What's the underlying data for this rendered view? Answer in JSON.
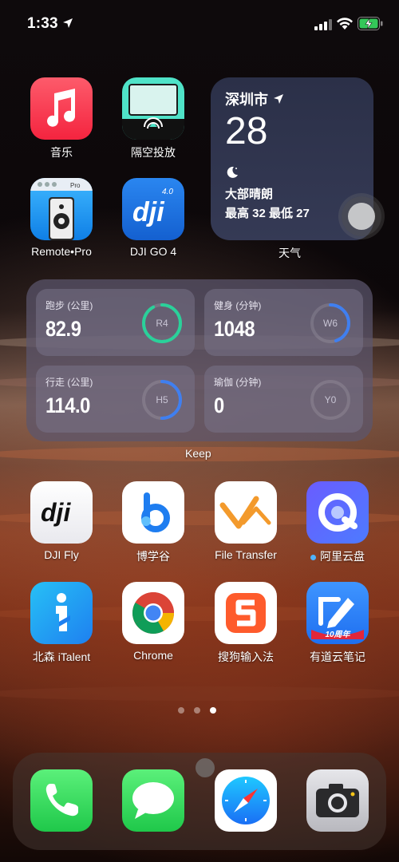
{
  "status_bar": {
    "time": "1:33"
  },
  "apps_row1": [
    {
      "label": "音乐"
    },
    {
      "label": "隔空投放"
    }
  ],
  "apps_row2": [
    {
      "label": "Remote•Pro"
    },
    {
      "label": "DJI GO 4"
    }
  ],
  "weather": {
    "city": "深圳市",
    "temperature": "28",
    "condition": "大部晴朗",
    "high_low": "最高 32 最低 27",
    "widget_label": "天气"
  },
  "keep": {
    "widget_label": "Keep",
    "cards": [
      {
        "label": "跑步 (公里)",
        "value": "82.9",
        "ring_label": "R4",
        "progress": 0.92,
        "color": "#2ad19a"
      },
      {
        "label": "健身 (分钟)",
        "value": "1048",
        "ring_label": "W6",
        "progress": 0.45,
        "color": "#3f7ff0"
      },
      {
        "label": "行走 (公里)",
        "value": "114.0",
        "ring_label": "H5",
        "progress": 0.5,
        "color": "#3f7ff0"
      },
      {
        "label": "瑜伽 (分钟)",
        "value": "0",
        "ring_label": "Y0",
        "progress": 0,
        "color": "#3f7ff0"
      }
    ]
  },
  "apps_row3": [
    {
      "label": "DJI Fly"
    },
    {
      "label": "博学谷"
    },
    {
      "label": "File Transfer"
    },
    {
      "label": "阿里云盘"
    }
  ],
  "apps_row4": [
    {
      "label": "北森 iTalent"
    },
    {
      "label": "Chrome"
    },
    {
      "label": "搜狗输入法"
    },
    {
      "label": "有道云笔记"
    }
  ],
  "youdao_badge": "10周年",
  "page_dots": {
    "count": 3,
    "active": 3
  },
  "dock": [
    {
      "icon": "phone-icon"
    },
    {
      "icon": "messages-icon"
    },
    {
      "icon": "safari-icon"
    },
    {
      "icon": "camera-icon"
    }
  ],
  "colors": {
    "music": "#fc3c44",
    "airplay_teal": "#4fe3c8",
    "dji_blue": "#1e6fe0",
    "keep_run": "#2ad19a",
    "keep_blue": "#3f7ff0",
    "phone_green": "#34c759",
    "sogou_red": "#fe5b2c"
  }
}
